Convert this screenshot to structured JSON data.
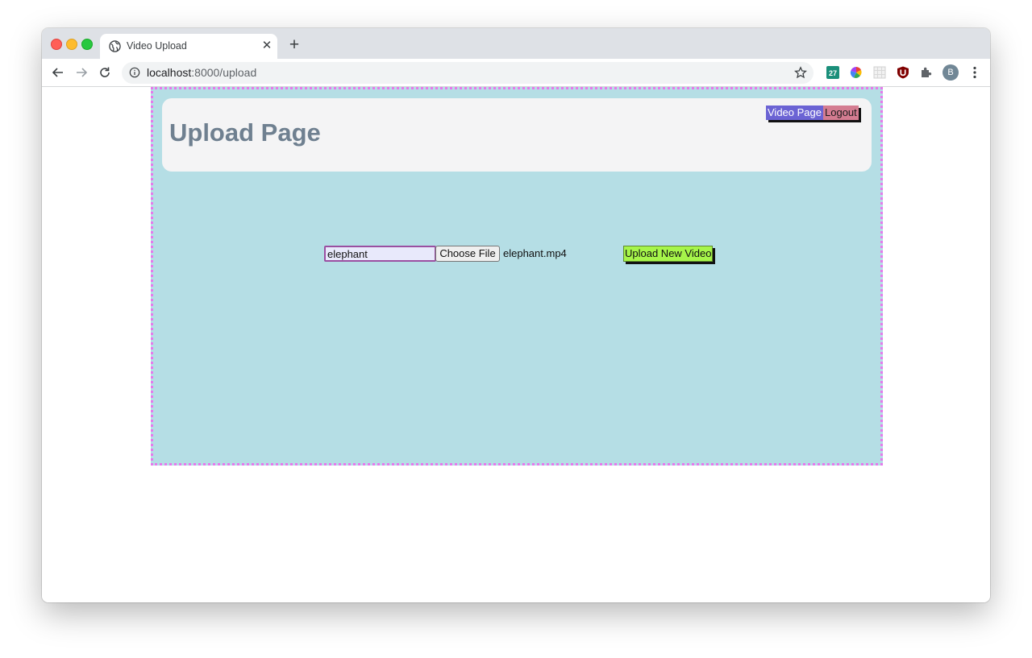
{
  "browser": {
    "tab_title": "Video Upload",
    "url_host": "localhost",
    "url_path": ":8000/upload",
    "avatar_letter": "B",
    "extensions": [
      "calendar-27-icon",
      "color-wheel-icon",
      "grid-icon",
      "ublock-icon",
      "puzzle-icon"
    ],
    "extension_calendar_text": "27"
  },
  "page": {
    "title": "Upload Page",
    "nav": {
      "video_page_label": "Video Page",
      "logout_label": "Logout"
    },
    "form": {
      "name_value": "elephant",
      "choose_file_label": "Choose File",
      "file_name": "elephant.mp4",
      "upload_label": "Upload New Video"
    }
  },
  "colors": {
    "page_background": "#b5dee5",
    "border_dots": "#e679ec",
    "header_background": "#f4f4f5",
    "title_color": "#6f8090",
    "video_button": "#6b63d4",
    "logout_button": "#d47c91",
    "upload_button": "#a6f54a"
  }
}
